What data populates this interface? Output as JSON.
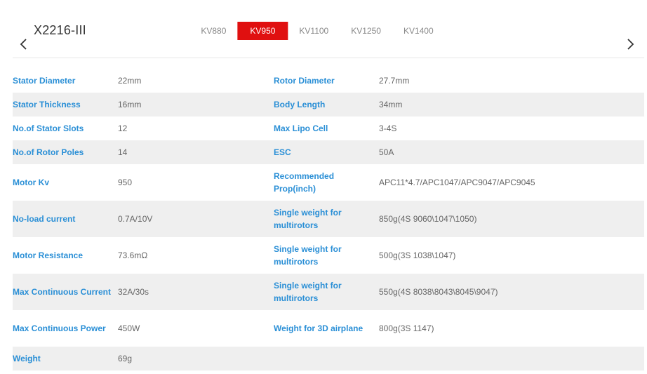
{
  "header": {
    "model_title": "X2216-III",
    "tabs": [
      {
        "label": "KV880",
        "active": false
      },
      {
        "label": "KV950",
        "active": true
      },
      {
        "label": "KV1100",
        "active": false
      },
      {
        "label": "KV1250",
        "active": false
      },
      {
        "label": "KV1400",
        "active": false
      }
    ],
    "prev_icon": "chevron-left-icon",
    "next_icon": "chevron-right-icon"
  },
  "specs": {
    "rows": [
      {
        "l1": "Stator Diameter",
        "v1": "22mm",
        "l2": "Rotor Diameter",
        "v2": "27.7mm"
      },
      {
        "l1": "Stator Thickness",
        "v1": "16mm",
        "l2": "Body Length",
        "v2": "34mm"
      },
      {
        "l1": "No.of Stator Slots",
        "v1": "12",
        "l2": "Max Lipo Cell",
        "v2": "3-4S"
      },
      {
        "l1": "No.of Rotor Poles",
        "v1": "14",
        "l2": "ESC",
        "v2": "50A"
      },
      {
        "l1": "Motor Kv",
        "v1": "950",
        "l2": "Recommended Prop(inch)",
        "v2": "APC11*4.7/APC1047/APC9047/APC9045"
      },
      {
        "l1": "No-load current",
        "v1": "0.7A/10V",
        "l2": "Single weight for multirotors",
        "v2": "850g(4S 9060\\1047\\1050)"
      },
      {
        "l1": "Motor Resistance",
        "v1": "73.6mΩ",
        "l2": "Single weight for multirotors",
        "v2": "500g(3S 1038\\1047)"
      },
      {
        "l1": "Max Continuous Current",
        "v1": "32A/30s",
        "l2": "Single weight for multirotors",
        "v2": "550g(4S 8038\\8043\\8045\\9047)"
      },
      {
        "l1": "Max Continuous Power",
        "v1": "450W",
        "l2": "Weight for 3D airplane",
        "v2": "800g(3S 1147)"
      },
      {
        "l1": "Weight",
        "v1": "69g",
        "l2": "",
        "v2": ""
      }
    ]
  },
  "colors": {
    "accent": "#e01010",
    "label": "#2a8fd6",
    "value": "#666666",
    "row_shade": "#efefef"
  }
}
